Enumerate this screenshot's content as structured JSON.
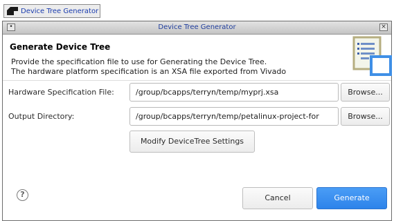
{
  "taskbar": {
    "task_label": "Device Tree Generator"
  },
  "window": {
    "title": "Device Tree Generator",
    "menu_glyph": "•",
    "close_glyph": "×"
  },
  "header": {
    "title": "Generate Device Tree",
    "line1": "Provide the specification file to use for Generating the Device Tree.",
    "line2": "The hardware platform specification is an XSA file exported from Vivado",
    "icon": "device-tree-document-icon"
  },
  "form": {
    "hw_label": "Hardware Specification File:",
    "hw_value": "/group/bcapps/terryn/temp/myprj.xsa",
    "out_label": "Output Directory:",
    "out_value": "/group/bcapps/terryn/temp/petalinux-project-for",
    "browse_label": "Browse...",
    "modify_label": "Modify DeviceTree Settings"
  },
  "footer": {
    "help_glyph": "?",
    "cancel_label": "Cancel",
    "generate_label": "Generate"
  },
  "colors": {
    "accent": "#2d83ea",
    "title_text": "#1f3d9c"
  }
}
